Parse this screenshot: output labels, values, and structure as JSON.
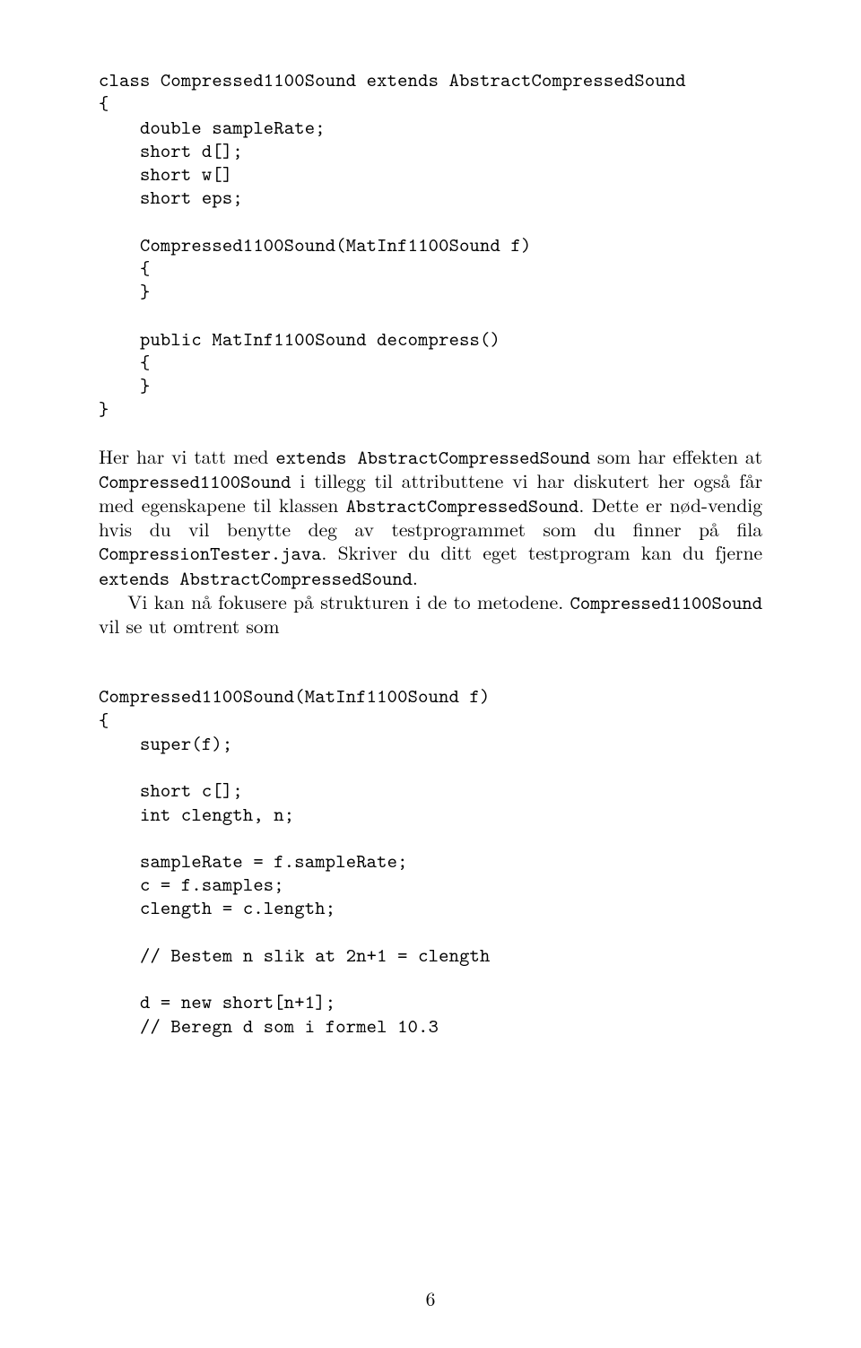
{
  "code1": {
    "l1": "class Compressed1100Sound extends AbstractCompressedSound",
    "l2": "{",
    "l3": "    double sampleRate;",
    "l4": "    short d[];",
    "l5": "    short w[]",
    "l6": "    short eps;",
    "l7": "    Compressed1100Sound(MatInf1100Sound f)",
    "l8": "    {",
    "l9": "    }",
    "l10": "    public MatInf1100Sound decompress()",
    "l11": "    {",
    "l12": "    }",
    "l13": "}"
  },
  "para1": {
    "t1": "Her har vi tatt med ",
    "c1": "extends AbstractCompressedSound",
    "t2": " som har effekten at ",
    "c2": "Compressed1100Sound",
    "t3": " i tillegg til attributtene vi har diskutert her også får med egenskapene til klassen ",
    "c3": "AbstractCompressedSound",
    "t4": ". Dette er nød-vendig hvis du vil benytte deg av testprogrammet som du finner på fila ",
    "c4": "CompressionTester.java",
    "t5": ". Skriver du ditt eget testprogram kan du fjerne ",
    "c5": "extends AbstractCompressedSound",
    "t6": "."
  },
  "para2": {
    "t1": "Vi kan nå fokusere på strukturen i de to metodene. ",
    "c1": "Compressed1100Sound",
    "t2": " vil se ut omtrent som"
  },
  "code2": {
    "l1": "Compressed1100Sound(MatInf1100Sound f)",
    "l2": "{",
    "l3": "    super(f);",
    "l4": "    short c[];",
    "l5": "    int clength, n;",
    "l6": "    sampleRate = f.sampleRate;",
    "l7": "    c = f.samples;",
    "l8": "    clength = c.length;",
    "l9": "    // Bestem n slik at 2n+1 = clength",
    "l10": "    d = new short[n+1];",
    "l11": "    // Beregn d som i formel 10.3"
  },
  "pageNumber": "6"
}
